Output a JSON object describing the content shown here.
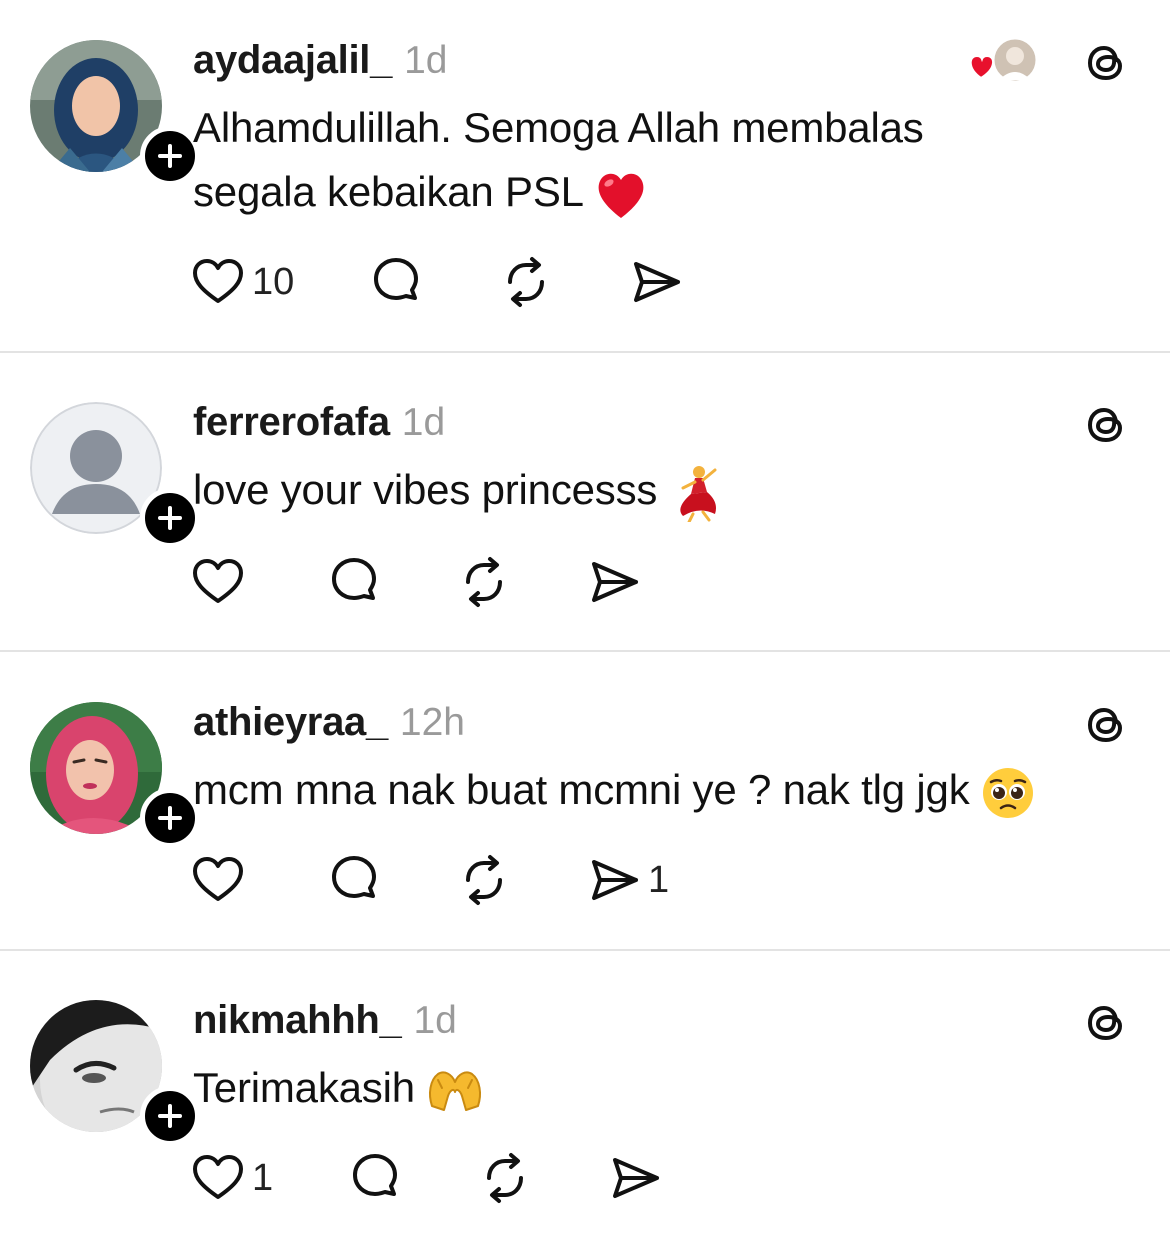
{
  "posts": [
    {
      "username": "aydaajalil_",
      "time": "1d",
      "lines": [
        "Alhamdulillah. Semoga Allah membalas",
        "segala kebaikan PSL"
      ],
      "emoji": "❤️",
      "likes": "10",
      "reply_count": "",
      "repost_count": "",
      "share_count": "",
      "liked_by_author": true
    },
    {
      "username": "ferrerofafa",
      "time": "1d",
      "lines": [
        "love your vibes princesss"
      ],
      "emoji": "💃",
      "likes": "",
      "reply_count": "",
      "repost_count": "",
      "share_count": ""
    },
    {
      "username": "athieyraa_",
      "time": "12h",
      "lines": [
        "mcm mna nak buat mcmni ye ? nak tlg jgk"
      ],
      "emoji": "🥺",
      "likes": "",
      "reply_count": "",
      "repost_count": "",
      "share_count": "1"
    },
    {
      "username": "nikmahhh_",
      "time": "1d",
      "lines": [
        "Terimakasih"
      ],
      "emoji": "🫶",
      "likes": "1",
      "reply_count": "",
      "repost_count": "",
      "share_count": ""
    }
  ],
  "icons": {
    "like": "heart-icon",
    "reply": "comment-bubble-icon",
    "repost": "repost-arrows-icon",
    "share": "send-icon",
    "app": "threads-logo-icon",
    "follow": "plus-icon"
  },
  "colors": {
    "username": "#1a1a1a",
    "timestamp": "#9a9a9a",
    "divider": "#e3e3e3",
    "heart_red": "#e0245e"
  }
}
